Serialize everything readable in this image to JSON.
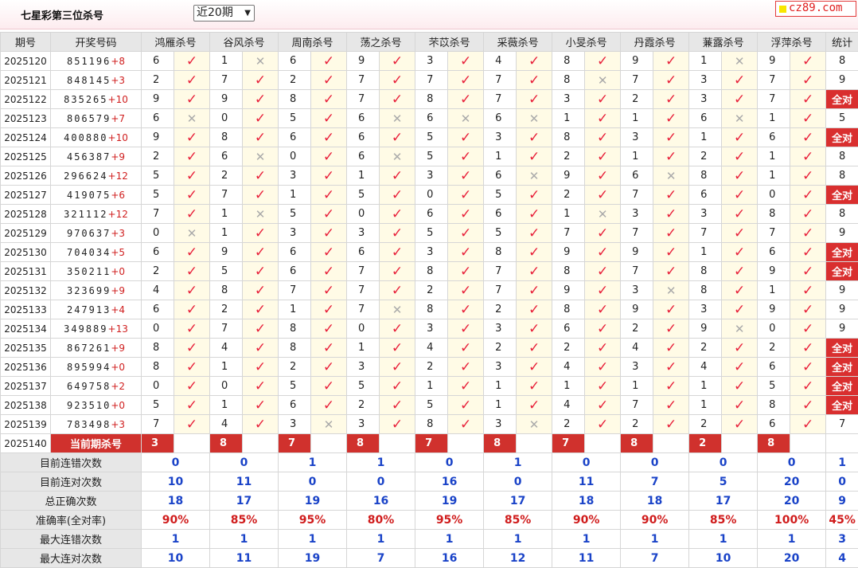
{
  "header": {
    "title": "七星彩第三位杀号",
    "period_select": "近20期",
    "logo": "cz89.com"
  },
  "columns": {
    "issue": "期号",
    "numbers": "开奖号码",
    "experts": [
      "鸿雁杀号",
      "谷风杀号",
      "周南杀号",
      "荡之杀号",
      "芣苡杀号",
      "采薇杀号",
      "小旻杀号",
      "丹霞杀号",
      "蒹露杀号",
      "浮萍杀号"
    ],
    "stat": "统计"
  },
  "marks": {
    "ok": "✓",
    "x": "✕"
  },
  "rows": [
    {
      "issue": "2025120",
      "draw": "851196",
      "plus": "+8",
      "picks": [
        6,
        1,
        6,
        9,
        3,
        4,
        8,
        9,
        1,
        9
      ],
      "hits": [
        1,
        0,
        1,
        1,
        1,
        1,
        1,
        1,
        0,
        1
      ],
      "stat": "8"
    },
    {
      "issue": "2025121",
      "draw": "848145",
      "plus": "+3",
      "picks": [
        2,
        7,
        2,
        7,
        7,
        7,
        8,
        7,
        3,
        7
      ],
      "hits": [
        1,
        1,
        1,
        1,
        1,
        1,
        0,
        1,
        1,
        1
      ],
      "stat": "9"
    },
    {
      "issue": "2025122",
      "draw": "835265",
      "plus": "+10",
      "picks": [
        9,
        9,
        8,
        7,
        8,
        7,
        3,
        2,
        3,
        7
      ],
      "hits": [
        1,
        1,
        1,
        1,
        1,
        1,
        1,
        1,
        1,
        1
      ],
      "stat": "全对"
    },
    {
      "issue": "2025123",
      "draw": "806579",
      "plus": "+7",
      "picks": [
        6,
        0,
        5,
        6,
        6,
        6,
        1,
        1,
        6,
        1
      ],
      "hits": [
        0,
        1,
        1,
        0,
        0,
        0,
        1,
        1,
        0,
        1
      ],
      "stat": "5"
    },
    {
      "issue": "2025124",
      "draw": "400880",
      "plus": "+10",
      "picks": [
        9,
        8,
        6,
        6,
        5,
        3,
        8,
        3,
        1,
        6
      ],
      "hits": [
        1,
        1,
        1,
        1,
        1,
        1,
        1,
        1,
        1,
        1
      ],
      "stat": "全对"
    },
    {
      "issue": "2025125",
      "draw": "456387",
      "plus": "+9",
      "picks": [
        2,
        6,
        0,
        6,
        5,
        1,
        2,
        1,
        2,
        1
      ],
      "hits": [
        1,
        0,
        1,
        0,
        1,
        1,
        1,
        1,
        1,
        1
      ],
      "stat": "8"
    },
    {
      "issue": "2025126",
      "draw": "296624",
      "plus": "+12",
      "picks": [
        5,
        2,
        3,
        1,
        3,
        6,
        9,
        6,
        8,
        1
      ],
      "hits": [
        1,
        1,
        1,
        1,
        1,
        0,
        1,
        0,
        1,
        1
      ],
      "stat": "8"
    },
    {
      "issue": "2025127",
      "draw": "419075",
      "plus": "+6",
      "picks": [
        5,
        7,
        1,
        5,
        0,
        5,
        2,
        7,
        6,
        0
      ],
      "hits": [
        1,
        1,
        1,
        1,
        1,
        1,
        1,
        1,
        1,
        1
      ],
      "stat": "全对"
    },
    {
      "issue": "2025128",
      "draw": "321112",
      "plus": "+12",
      "picks": [
        7,
        1,
        5,
        0,
        6,
        6,
        1,
        3,
        3,
        8
      ],
      "hits": [
        1,
        0,
        1,
        1,
        1,
        1,
        0,
        1,
        1,
        1
      ],
      "stat": "8"
    },
    {
      "issue": "2025129",
      "draw": "970637",
      "plus": "+3",
      "picks": [
        0,
        1,
        3,
        3,
        5,
        5,
        7,
        7,
        7,
        7
      ],
      "hits": [
        0,
        1,
        1,
        1,
        1,
        1,
        1,
        1,
        1,
        1
      ],
      "stat": "9"
    },
    {
      "issue": "2025130",
      "draw": "704034",
      "plus": "+5",
      "picks": [
        6,
        9,
        6,
        6,
        3,
        8,
        9,
        9,
        1,
        6
      ],
      "hits": [
        1,
        1,
        1,
        1,
        1,
        1,
        1,
        1,
        1,
        1
      ],
      "stat": "全对"
    },
    {
      "issue": "2025131",
      "draw": "350211",
      "plus": "+0",
      "picks": [
        2,
        5,
        6,
        7,
        8,
        7,
        8,
        7,
        8,
        9
      ],
      "hits": [
        1,
        1,
        1,
        1,
        1,
        1,
        1,
        1,
        1,
        1
      ],
      "stat": "全对"
    },
    {
      "issue": "2025132",
      "draw": "323699",
      "plus": "+9",
      "picks": [
        4,
        8,
        7,
        7,
        2,
        7,
        9,
        3,
        8,
        1
      ],
      "hits": [
        1,
        1,
        1,
        1,
        1,
        1,
        1,
        0,
        1,
        1
      ],
      "stat": "9"
    },
    {
      "issue": "2025133",
      "draw": "247913",
      "plus": "+4",
      "picks": [
        6,
        2,
        1,
        7,
        8,
        2,
        8,
        9,
        3,
        9
      ],
      "hits": [
        1,
        1,
        1,
        0,
        1,
        1,
        1,
        1,
        1,
        1
      ],
      "stat": "9"
    },
    {
      "issue": "2025134",
      "draw": "349889",
      "plus": "+13",
      "picks": [
        0,
        7,
        8,
        0,
        3,
        3,
        6,
        2,
        9,
        0
      ],
      "hits": [
        1,
        1,
        1,
        1,
        1,
        1,
        1,
        1,
        0,
        1
      ],
      "stat": "9"
    },
    {
      "issue": "2025135",
      "draw": "867261",
      "plus": "+9",
      "picks": [
        8,
        4,
        8,
        1,
        4,
        2,
        2,
        4,
        2,
        2
      ],
      "hits": [
        1,
        1,
        1,
        1,
        1,
        1,
        1,
        1,
        1,
        1
      ],
      "stat": "全对"
    },
    {
      "issue": "2025136",
      "draw": "895994",
      "plus": "+0",
      "picks": [
        8,
        1,
        2,
        3,
        2,
        3,
        4,
        3,
        4,
        6
      ],
      "hits": [
        1,
        1,
        1,
        1,
        1,
        1,
        1,
        1,
        1,
        1
      ],
      "stat": "全对"
    },
    {
      "issue": "2025137",
      "draw": "649758",
      "plus": "+2",
      "picks": [
        0,
        0,
        5,
        5,
        1,
        1,
        1,
        1,
        1,
        5
      ],
      "hits": [
        1,
        1,
        1,
        1,
        1,
        1,
        1,
        1,
        1,
        1
      ],
      "stat": "全对"
    },
    {
      "issue": "2025138",
      "draw": "923510",
      "plus": "+0",
      "picks": [
        5,
        1,
        6,
        2,
        5,
        1,
        4,
        7,
        1,
        8
      ],
      "hits": [
        1,
        1,
        1,
        1,
        1,
        1,
        1,
        1,
        1,
        1
      ],
      "stat": "全对"
    },
    {
      "issue": "2025139",
      "draw": "783498",
      "plus": "+3",
      "picks": [
        7,
        4,
        3,
        3,
        8,
        3,
        2,
        2,
        2,
        6
      ],
      "hits": [
        1,
        1,
        0,
        1,
        1,
        0,
        1,
        1,
        1,
        1
      ],
      "stat": "7"
    }
  ],
  "current": {
    "issue": "2025140",
    "label": "当前期杀号",
    "picks": [
      3,
      8,
      7,
      8,
      7,
      8,
      7,
      8,
      2,
      8
    ]
  },
  "summary": [
    {
      "label": "目前连错次数",
      "values": [
        "0",
        "0",
        "1",
        "1",
        "0",
        "1",
        "0",
        "0",
        "0",
        "0"
      ],
      "stat": "1",
      "red": false
    },
    {
      "label": "目前连对次数",
      "values": [
        "10",
        "11",
        "0",
        "0",
        "16",
        "0",
        "11",
        "7",
        "5",
        "20"
      ],
      "stat": "0",
      "red": false
    },
    {
      "label": "总正确次数",
      "values": [
        "18",
        "17",
        "19",
        "16",
        "19",
        "17",
        "18",
        "18",
        "17",
        "20"
      ],
      "stat": "9",
      "red": false
    },
    {
      "label": "准确率(全对率)",
      "values": [
        "90%",
        "85%",
        "95%",
        "80%",
        "95%",
        "85%",
        "90%",
        "90%",
        "85%",
        "100%"
      ],
      "stat": "45%",
      "red": true
    },
    {
      "label": "最大连错次数",
      "values": [
        "1",
        "1",
        "1",
        "1",
        "1",
        "1",
        "1",
        "1",
        "1",
        "1"
      ],
      "stat": "3",
      "red": false
    },
    {
      "label": "最大连对次数",
      "values": [
        "10",
        "11",
        "19",
        "7",
        "16",
        "12",
        "11",
        "7",
        "10",
        "20"
      ],
      "stat": "4",
      "red": false
    }
  ]
}
